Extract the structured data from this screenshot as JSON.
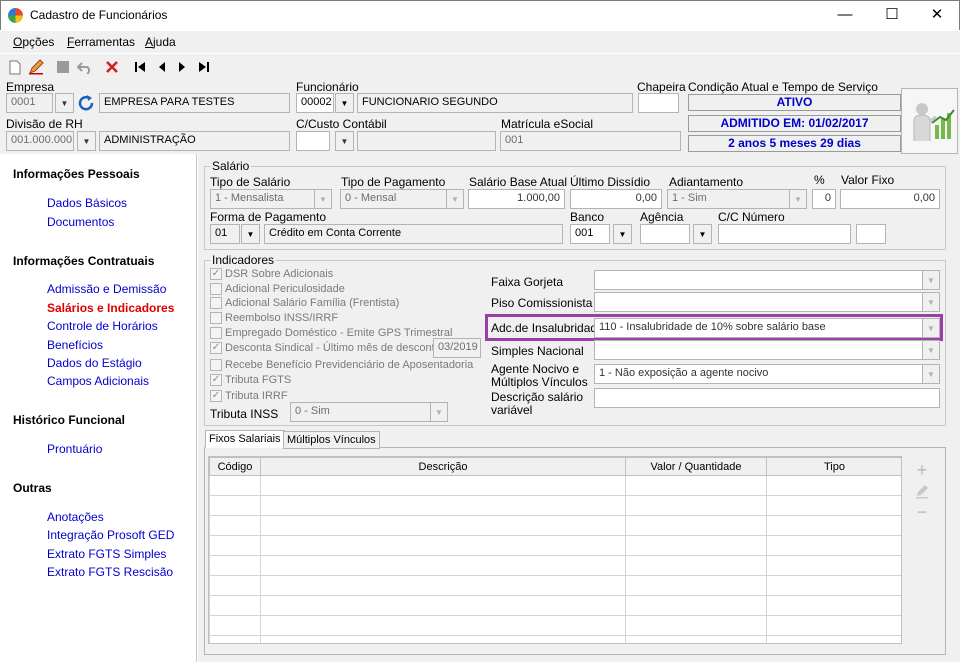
{
  "window": {
    "title": "Cadastro de Funcionários",
    "minimize": "—",
    "maximize": "☐",
    "close": "✕"
  },
  "menu": [
    {
      "accel": "O",
      "rest": "pções"
    },
    {
      "accel": "F",
      "rest": "erramentas"
    },
    {
      "accel": "A",
      "rest": "juda"
    }
  ],
  "toolbar": [
    "new-icon",
    "edit-icon",
    "save-icon",
    "undo-icon",
    "delete-icon",
    "first-icon",
    "prev-icon",
    "next-icon",
    "last-icon"
  ],
  "header": {
    "empresa_label": "Empresa",
    "empresa_code": "0001",
    "empresa_name": "EMPRESA PARA TESTES",
    "funcionario_label": "Funcionário",
    "funcionario_code": "00002",
    "funcionario_name": "FUNCIONARIO SEGUNDO",
    "chapeira_label": "Chapeira",
    "chapeira_value": "",
    "divisao_label": "Divisão de RH",
    "divisao_code": "001.000.000",
    "divisao_name": "ADMINISTRAÇÃO",
    "custo_label": "C/Custo Contábil",
    "custo_value": "",
    "matricula_label": "Matrícula eSocial",
    "matricula_value": "001",
    "condicao_label": "Condição Atual e Tempo de Serviço",
    "status": "ATIVO",
    "admitido": "ADMITIDO EM: 01/02/2017",
    "tempo": "2 anos 5 meses 29 dias"
  },
  "sidebar": {
    "sections": [
      {
        "title": "Informações Pessoais",
        "items": [
          "Dados Básicos",
          "Documentos"
        ]
      },
      {
        "title": "Informações Contratuais",
        "items": [
          "Admissão e Demissão",
          "Salários e Indicadores",
          "Controle de Horários",
          "Benefícios",
          "Dados do Estágio",
          "Campos Adicionais"
        ]
      },
      {
        "title": "Histórico Funcional",
        "items": [
          "Prontuário"
        ]
      },
      {
        "title": "Outras",
        "items": [
          "Anotações",
          "Integração Prosoft GED",
          "Extrato FGTS Simples",
          "Extrato FGTS Rescisão"
        ]
      }
    ],
    "active": "Salários e Indicadores"
  },
  "salario": {
    "legend": "Salário",
    "tipo_label": "Tipo de Salário",
    "tipo_value": "1 - Mensalista",
    "pagto_label": "Tipo de Pagamento",
    "pagto_value": "0 - Mensal",
    "base_label": "Salário Base Atual",
    "base_value": "1.000,00",
    "dissidio_label": "Último Dissídio",
    "dissidio_value": "0,00",
    "adiant_label": "Adiantamento",
    "adiant_value": "1 - Sim",
    "pct_label": "%",
    "pct_value": "0",
    "fixo_label": "Valor Fixo",
    "fixo_value": "0,00",
    "forma_label": "Forma de Pagamento",
    "forma_code": "01",
    "forma_name": "Crédito em Conta Corrente",
    "banco_label": "Banco",
    "banco_value": "001",
    "agencia_label": "Agência",
    "agencia_value": "",
    "cc_label": "C/C Número",
    "cc_value": "",
    "cc_dv": ""
  },
  "indicadores": {
    "legend": "Indicadores",
    "checks": [
      {
        "label": "DSR Sobre Adicionais",
        "checked": true
      },
      {
        "label": "Adicional Periculosidade",
        "checked": false
      },
      {
        "label": "Adicional Salário Família (Frentista)",
        "checked": false
      },
      {
        "label": "Reembolso INSS/IRRF",
        "checked": false
      },
      {
        "label": "Empregado Doméstico - Emite GPS Trimestral",
        "checked": false
      },
      {
        "label": "Desconta Sindical - Último mês de desconto",
        "checked": true
      },
      {
        "label": "Recebe Benefício Previdenciário de Aposentadoria",
        "checked": false
      },
      {
        "label": "Tributa FGTS",
        "checked": true
      },
      {
        "label": "Tributa IRRF",
        "checked": true
      }
    ],
    "sindical_mes": "03/2019",
    "inss_label": "Tributa INSS",
    "inss_value": "0 - Sim",
    "gorjeta_label": "Faixa Gorjeta",
    "gorjeta_value": "",
    "piso_label": "Piso Comissionista",
    "piso_value": "",
    "insal_label": "Adc.de Insalubridade",
    "insal_value": "110 - Insalubridade de 10% sobre salário base",
    "simples_label": "Simples Nacional",
    "simples_value": "",
    "agente_label1": "Agente Nocivo e",
    "agente_label2": "Múltiplos Vínculos",
    "agente_value": "1 - Não exposição a agente nocivo",
    "desc_label1": "Descrição salário",
    "desc_label2": "variável",
    "desc_value": ""
  },
  "tabs": [
    "Fixos Salariais",
    "Múltiplos Vínculos"
  ],
  "grid": {
    "columns": [
      "Código",
      "Descrição",
      "Valor / Quantidade",
      "Tipo"
    ],
    "rows": 9
  },
  "grid_actions": [
    "add-icon",
    "edit-pencil-icon",
    "remove-icon"
  ],
  "colors": {
    "link": "#0000cc",
    "active_link": "#e00000",
    "highlight": "#9b3fa8"
  }
}
